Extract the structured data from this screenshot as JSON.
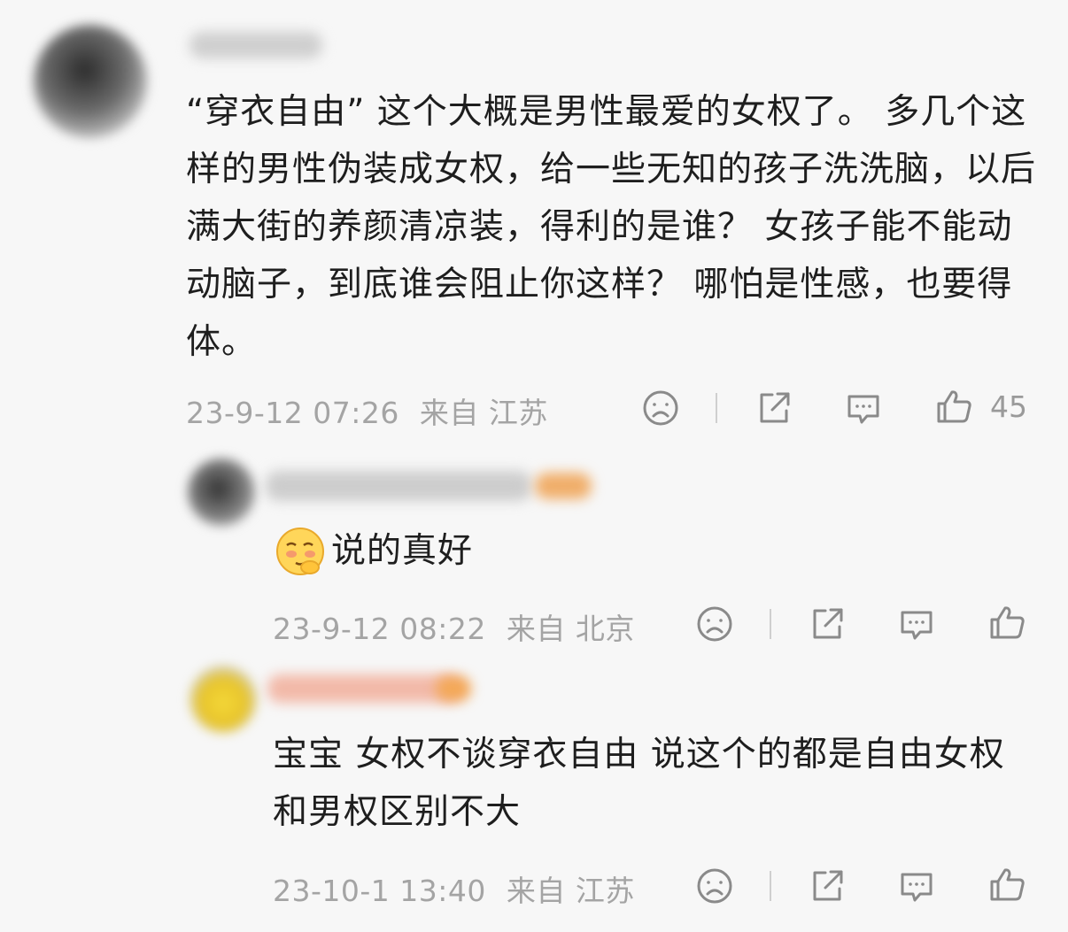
{
  "comments": [
    {
      "text": "“穿衣自由” 这个大概是男性最爱的女权了。 多几个这样的男性伪装成女权，给一些无知的孩子洗洗脑，以后满大街的养颜清凉装，得利的是谁？ 女孩子能不能动动脑子，到底谁会阻止你这样？ 哪怕是性感，也要得体。",
      "time": "23-9-12 07:26",
      "location": "来自 江苏",
      "likes": "45"
    },
    {
      "text": "说的真好",
      "time": "23-9-12 08:22",
      "location": "来自 北京"
    },
    {
      "text": "宝宝 女权不谈穿衣自由 说这个的都是自由女权 和男权区别不大",
      "time": "23-10-1 13:40",
      "location": "来自 江苏"
    }
  ],
  "icons": {
    "dislike": "sad-face-icon",
    "share": "share-icon",
    "reply": "comment-icon",
    "like": "thumbs-up-icon"
  },
  "colors": {
    "background": "#f7f7f7",
    "text": "#1e1e1e",
    "meta": "#a4a4a4",
    "icon": "#8a8a8a"
  }
}
